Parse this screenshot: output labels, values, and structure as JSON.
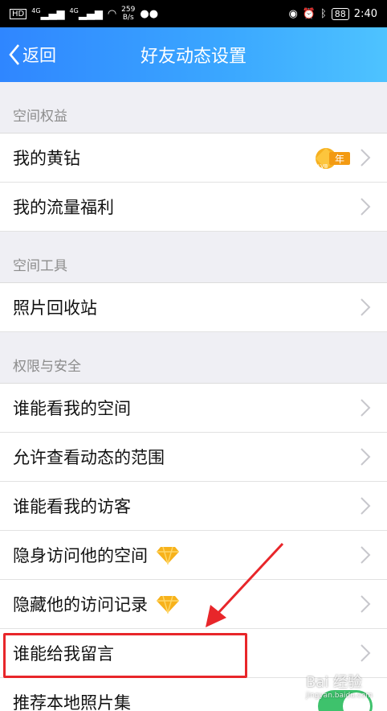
{
  "status_bar": {
    "left_badge": "HD",
    "signal_1": "4G",
    "signal_2": "4G",
    "speed_value": "259",
    "speed_unit": "B/s",
    "battery": "88",
    "time": "2:40"
  },
  "header": {
    "back_label": "返回",
    "title": "好友动态设置"
  },
  "sections": [
    {
      "title": "空间权益",
      "items": [
        {
          "label": "我的黄钻",
          "badge": "年",
          "badge_sub": "LV8"
        },
        {
          "label": "我的流量福利"
        }
      ]
    },
    {
      "title": "空间工具",
      "items": [
        {
          "label": "照片回收站"
        }
      ]
    },
    {
      "title": "权限与安全",
      "items": [
        {
          "label": "谁能看我的空间"
        },
        {
          "label": "允许查看动态的范围"
        },
        {
          "label": "谁能看我的访客"
        },
        {
          "label": "隐身访问他的空间",
          "icon": "diamond-icon"
        },
        {
          "label": "隐藏他的访问记录",
          "icon": "diamond-icon"
        },
        {
          "label": "谁能给我留言"
        },
        {
          "label": "推荐本地照片集"
        }
      ]
    }
  ],
  "colors": {
    "nav_start": "#2f86ff",
    "nav_end": "#4ec3ff",
    "highlight": "#e8262a",
    "toggle_on": "#3ec26c"
  },
  "watermark": {
    "main": "Bai 经验",
    "sub": "jingyan.baidu.com"
  }
}
